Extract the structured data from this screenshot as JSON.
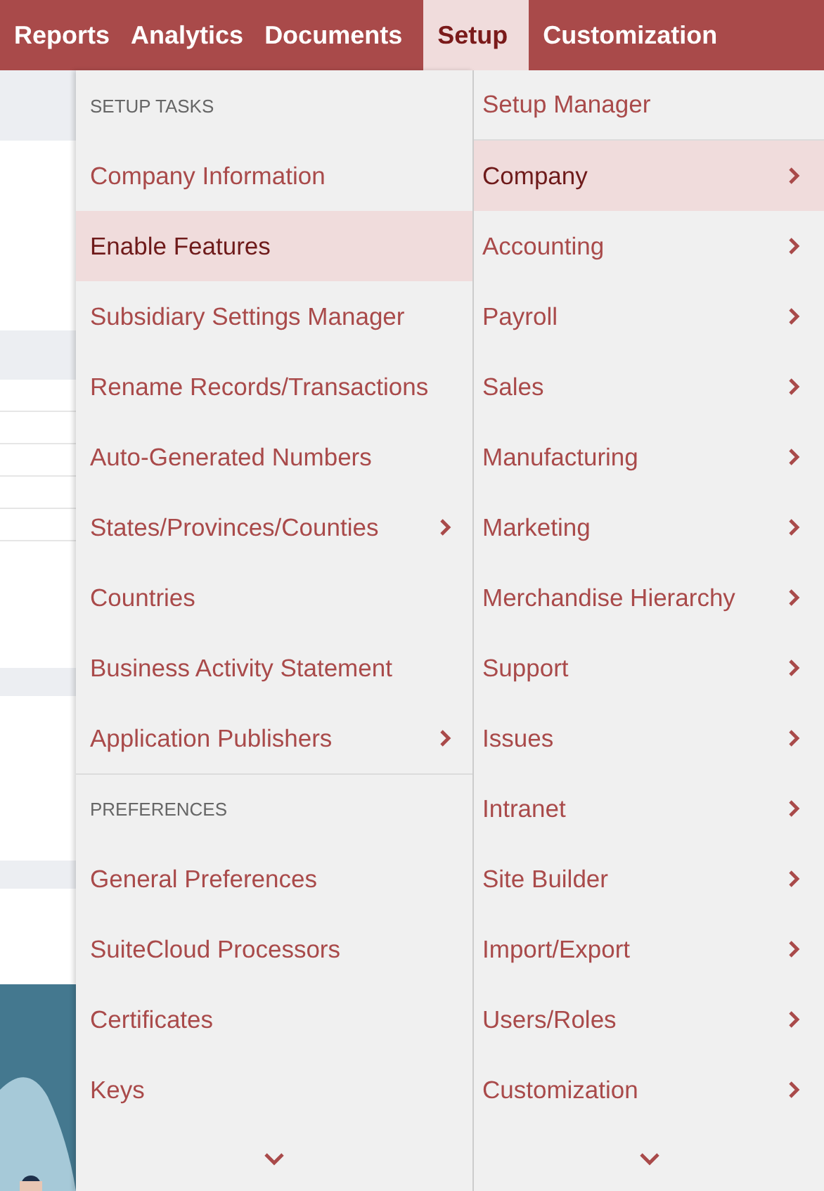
{
  "nav": {
    "tabs": [
      {
        "label": "Reports",
        "selected": false
      },
      {
        "label": "Analytics",
        "selected": false
      },
      {
        "label": "Documents",
        "selected": false
      },
      {
        "label": "Setup",
        "selected": true
      },
      {
        "label": "Customization",
        "selected": false
      }
    ]
  },
  "menu": {
    "sections": [
      {
        "heading": "SETUP TASKS",
        "items": [
          {
            "label": "Company Information",
            "selected": false,
            "submenu": false
          },
          {
            "label": "Enable Features",
            "selected": true,
            "submenu": false
          },
          {
            "label": "Subsidiary Settings Manager",
            "selected": false,
            "submenu": false
          },
          {
            "label": "Rename Records/Transactions",
            "selected": false,
            "submenu": false
          },
          {
            "label": "Auto-Generated Numbers",
            "selected": false,
            "submenu": false
          },
          {
            "label": "States/Provinces/Counties",
            "selected": false,
            "submenu": true
          },
          {
            "label": "Countries",
            "selected": false,
            "submenu": false
          },
          {
            "label": "Business Activity Statement",
            "selected": false,
            "submenu": false
          },
          {
            "label": "Application Publishers",
            "selected": false,
            "submenu": true
          }
        ]
      },
      {
        "heading": "PREFERENCES",
        "items": [
          {
            "label": "General Preferences",
            "selected": false,
            "submenu": false
          },
          {
            "label": "SuiteCloud Processors",
            "selected": false,
            "submenu": false
          },
          {
            "label": "Certificates",
            "selected": false,
            "submenu": false
          },
          {
            "label": "Keys",
            "selected": false,
            "submenu": false
          }
        ]
      }
    ],
    "more": true
  },
  "submenu": {
    "items": [
      {
        "label": "Setup Manager",
        "selected": false,
        "submenu": false
      },
      {
        "label": "Company",
        "selected": true,
        "submenu": true
      },
      {
        "label": "Accounting",
        "selected": false,
        "submenu": true
      },
      {
        "label": "Payroll",
        "selected": false,
        "submenu": true
      },
      {
        "label": "Sales",
        "selected": false,
        "submenu": true
      },
      {
        "label": "Manufacturing",
        "selected": false,
        "submenu": true
      },
      {
        "label": "Marketing",
        "selected": false,
        "submenu": true
      },
      {
        "label": "Merchandise Hierarchy",
        "selected": false,
        "submenu": true
      },
      {
        "label": "Support",
        "selected": false,
        "submenu": true
      },
      {
        "label": "Issues",
        "selected": false,
        "submenu": true
      },
      {
        "label": "Intranet",
        "selected": false,
        "submenu": true
      },
      {
        "label": "Site Builder",
        "selected": false,
        "submenu": true
      },
      {
        "label": "Import/Export",
        "selected": false,
        "submenu": true
      },
      {
        "label": "Users/Roles",
        "selected": false,
        "submenu": true
      },
      {
        "label": "Customization",
        "selected": false,
        "submenu": true
      }
    ],
    "more": true
  }
}
